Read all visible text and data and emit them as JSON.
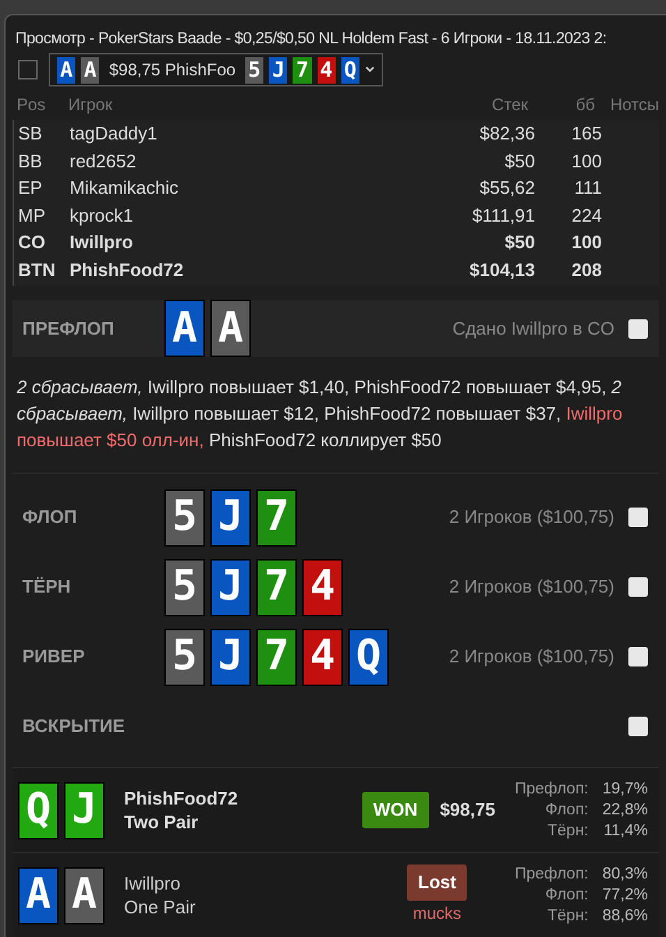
{
  "window": {
    "title": "Просмотр - PokerStars Baade - $0,25/$0,50 NL Holdem Fast - 6 Игроки - 18.11.2023 2:"
  },
  "hand_selector": {
    "checked": false,
    "hero_cards": [
      {
        "rank": "A",
        "color": "#0a56c0"
      },
      {
        "rank": "A",
        "color": "#5a5a5a"
      }
    ],
    "summary": "$98,75 PhishFoo",
    "board": [
      {
        "rank": "5",
        "color": "#5a5a5a"
      },
      {
        "rank": "J",
        "color": "#0a56c0"
      },
      {
        "rank": "7",
        "color": "#1f8f12"
      },
      {
        "rank": "4",
        "color": "#c40f0f"
      },
      {
        "rank": "Q",
        "color": "#0a56c0"
      }
    ]
  },
  "table": {
    "columns": [
      "Pos",
      "Игрок",
      "Стек",
      "бб",
      "Нотсы"
    ],
    "rows": [
      {
        "pos": "SB",
        "player": "tagDaddy1",
        "stack": "$82,36",
        "bb": "165",
        "hero": false
      },
      {
        "pos": "BB",
        "player": "red2652",
        "stack": "$50",
        "bb": "100",
        "hero": false
      },
      {
        "pos": "EP",
        "player": "Mikamikachic",
        "stack": "$55,62",
        "bb": "111",
        "hero": false
      },
      {
        "pos": "MP",
        "player": "kprock1",
        "stack": "$111,91",
        "bb": "224",
        "hero": false
      },
      {
        "pos": "CO",
        "player": "Iwillpro",
        "stack": "$50",
        "bb": "100",
        "hero": true
      },
      {
        "pos": "BTN",
        "player": "PhishFood72",
        "stack": "$104,13",
        "bb": "208",
        "hero": true
      }
    ]
  },
  "preflop": {
    "label": "ПРЕФЛОП",
    "cards": [
      {
        "rank": "A",
        "color": "#0a56c0"
      },
      {
        "rank": "A",
        "color": "#5a5a5a"
      }
    ],
    "info": "Сдано Iwillpro в CO",
    "checked": false,
    "actions": [
      {
        "text": "2 сбрасывает,",
        "kind": "fold"
      },
      {
        "text": "Iwillpro повышает $1,40, PhishFood72 повышает $4,95,",
        "kind": "plain"
      },
      {
        "text": "2 сбрасывает,",
        "kind": "fold"
      },
      {
        "text": "Iwillpro повышает $12, PhishFood72 повышает $37,",
        "kind": "plain"
      },
      {
        "text": "Iwillpro повышает $50 олл-ин,",
        "kind": "allin"
      },
      {
        "text": "PhishFood72 коллирует $50",
        "kind": "plain"
      }
    ]
  },
  "streets": [
    {
      "label": "ФЛОП",
      "cards": [
        {
          "rank": "5",
          "color": "#5a5a5a"
        },
        {
          "rank": "J",
          "color": "#0a56c0"
        },
        {
          "rank": "7",
          "color": "#1f8f12"
        }
      ],
      "info": "2 Игроков ($100,75)",
      "checked": false
    },
    {
      "label": "ТЁРН",
      "cards": [
        {
          "rank": "5",
          "color": "#5a5a5a"
        },
        {
          "rank": "J",
          "color": "#0a56c0"
        },
        {
          "rank": "7",
          "color": "#1f8f12"
        },
        {
          "rank": "4",
          "color": "#c40f0f"
        }
      ],
      "info": "2 Игроков ($100,75)",
      "checked": false
    },
    {
      "label": "РИВЕР",
      "cards": [
        {
          "rank": "5",
          "color": "#5a5a5a"
        },
        {
          "rank": "J",
          "color": "#0a56c0"
        },
        {
          "rank": "7",
          "color": "#1f8f12"
        },
        {
          "rank": "4",
          "color": "#c40f0f"
        },
        {
          "rank": "Q",
          "color": "#0a56c0"
        }
      ],
      "info": "2 Игроков ($100,75)",
      "checked": false
    },
    {
      "label": "ВСКРЫТИЕ",
      "checked": false
    }
  ],
  "showdown": [
    {
      "cards": [
        {
          "rank": "Q",
          "color": "#22a811"
        },
        {
          "rank": "J",
          "color": "#22a811"
        }
      ],
      "player": "PhishFood72",
      "hand": "Two Pair",
      "won": true,
      "badge": "WON",
      "amount": "$98,75",
      "equity": [
        {
          "street": "Префлоп:",
          "value": "19,7%"
        },
        {
          "street": "Флоп:",
          "value": "22,8%"
        },
        {
          "street": "Тёрн:",
          "value": "11,4%"
        }
      ]
    },
    {
      "cards": [
        {
          "rank": "A",
          "color": "#0a56c0"
        },
        {
          "rank": "A",
          "color": "#5a5a5a"
        }
      ],
      "player": "Iwillpro",
      "hand": "One Pair",
      "won": false,
      "badge": "Lost",
      "note": "mucks",
      "equity": [
        {
          "street": "Префлоп:",
          "value": "80,3%"
        },
        {
          "street": "Флоп:",
          "value": "77,2%"
        },
        {
          "street": "Тёрн:",
          "value": "88,6%"
        }
      ]
    }
  ]
}
